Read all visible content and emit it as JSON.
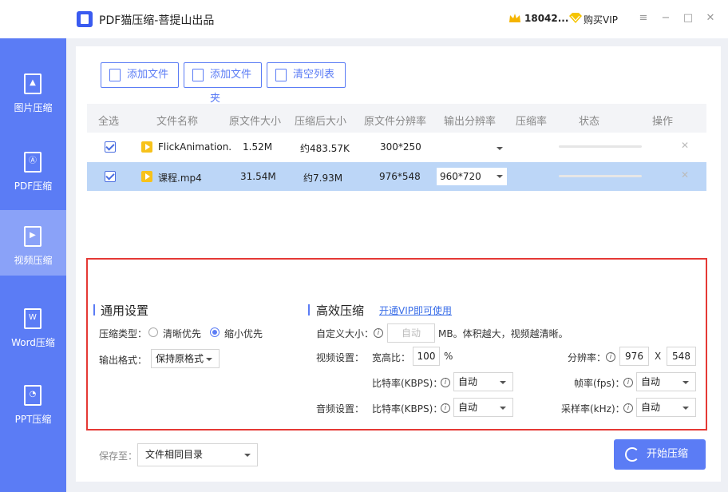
{
  "app": {
    "title": "PDF猫压缩-菩提山出品",
    "coins": "18042...",
    "vip_label": "购买VIP"
  },
  "sidebar": {
    "items": [
      {
        "label": "图片压缩",
        "icon": "image-file-icon"
      },
      {
        "label": "PDF压缩",
        "icon": "pdf-file-icon"
      },
      {
        "label": "视频压缩",
        "icon": "video-file-icon"
      },
      {
        "label": "Word压缩",
        "icon": "word-file-icon"
      },
      {
        "label": "PPT压缩",
        "icon": "ppt-file-icon"
      }
    ],
    "active_index": 2
  },
  "toolbar": {
    "add_file": "添加文件",
    "add_folder": "添加文件夹",
    "clear_list": "清空列表"
  },
  "table": {
    "headers": [
      "全选",
      "文件名称",
      "原文件大小",
      "压缩后大小",
      "原文件分辨率",
      "输出分辨率",
      "压缩率",
      "状态",
      "操作"
    ],
    "rows": [
      {
        "name": "FlickAnimation.",
        "orig_size": "1.52M",
        "new_size": "约483.57K",
        "orig_res": "300*250",
        "out_res": "",
        "selected": false
      },
      {
        "name": "课程.mp4",
        "orig_size": "31.54M",
        "new_size": "约7.93M",
        "orig_res": "976*548",
        "out_res": "960*720",
        "selected": true
      }
    ]
  },
  "general": {
    "title": "通用设置",
    "type_label": "压缩类型：",
    "opt_clear": "清晰优先",
    "opt_small": "缩小优先",
    "selected_option": "缩小优先",
    "format_label": "输出格式：",
    "format_value": "保持原格式"
  },
  "advanced": {
    "title": "高效压缩",
    "vip_link": "开通VIP即可使用",
    "custom_size_label": "自定义大小：",
    "custom_size_value": "自动",
    "custom_size_hint": "MB。体积越大，视频越清晰。",
    "video_label": "视频设置：",
    "aspect_label": "宽高比：",
    "aspect_value": "100",
    "aspect_unit": "%",
    "resolution_label": "分辨率：",
    "res_w": "976",
    "res_x": "X",
    "res_h": "548",
    "video_bitrate_label": "比特率(KBPS)：",
    "video_bitrate_value": "自动",
    "fps_label": "帧率(fps)：",
    "fps_value": "自动",
    "audio_label": "音频设置：",
    "audio_bitrate_label": "比特率(KBPS)：",
    "audio_bitrate_value": "自动",
    "sample_label": "采样率(kHz)：",
    "sample_value": "自动"
  },
  "footer": {
    "save_label": "保存至：",
    "save_value": "文件相同目录",
    "start_label": "开始压缩"
  },
  "colors": {
    "accent": "#5b7cf5",
    "highlight_border": "#e53935",
    "selected_row": "#bcd6f7"
  }
}
